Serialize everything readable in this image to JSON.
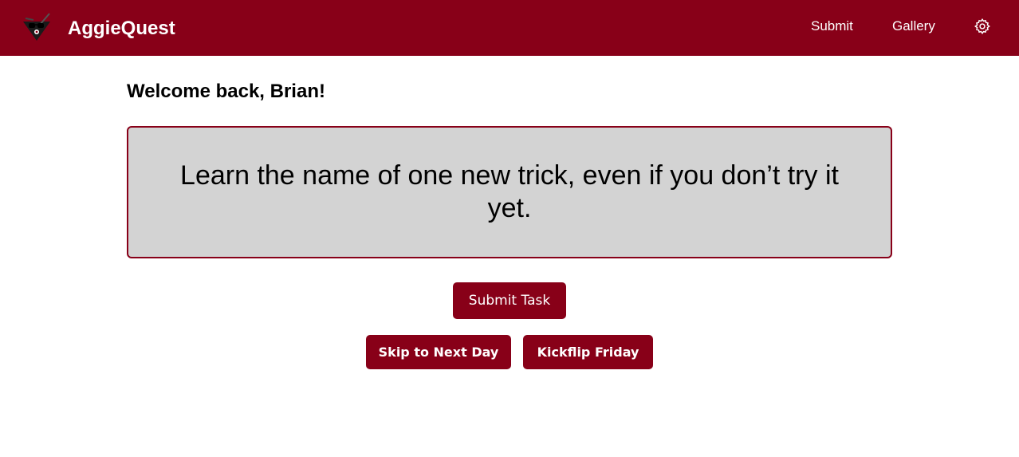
{
  "app": {
    "title": "AggieQuest",
    "logo_icon": "aggie-logo-icon",
    "brand_color": "#880018"
  },
  "nav": {
    "submit_label": "Submit",
    "gallery_label": "Gallery",
    "settings_icon": "gear-icon"
  },
  "main": {
    "welcome": "Welcome back, Brian!",
    "task_text": "Learn the name of one new trick, even if you don’t try it yet.",
    "card_background": "#d3d3d3"
  },
  "actions": {
    "submit_task_label": "Submit Task",
    "skip_label": "Skip to Next Day",
    "kickflip_label": "Kickflip Friday"
  }
}
